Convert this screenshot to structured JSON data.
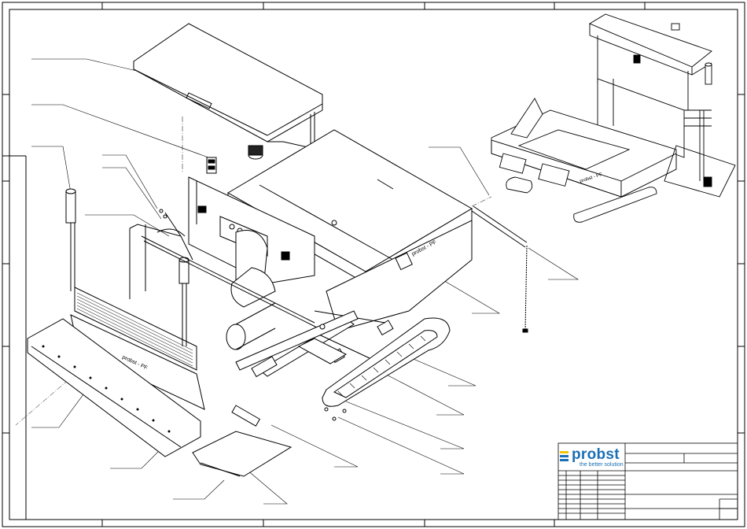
{
  "titleblock": {
    "brand": "probst",
    "tagline": "the better solution"
  },
  "colors": {
    "line": "#000000",
    "brand_blue": "#1a6fb5",
    "brand_yellow": "#f2c500"
  },
  "machine_decal": "probst - PF"
}
